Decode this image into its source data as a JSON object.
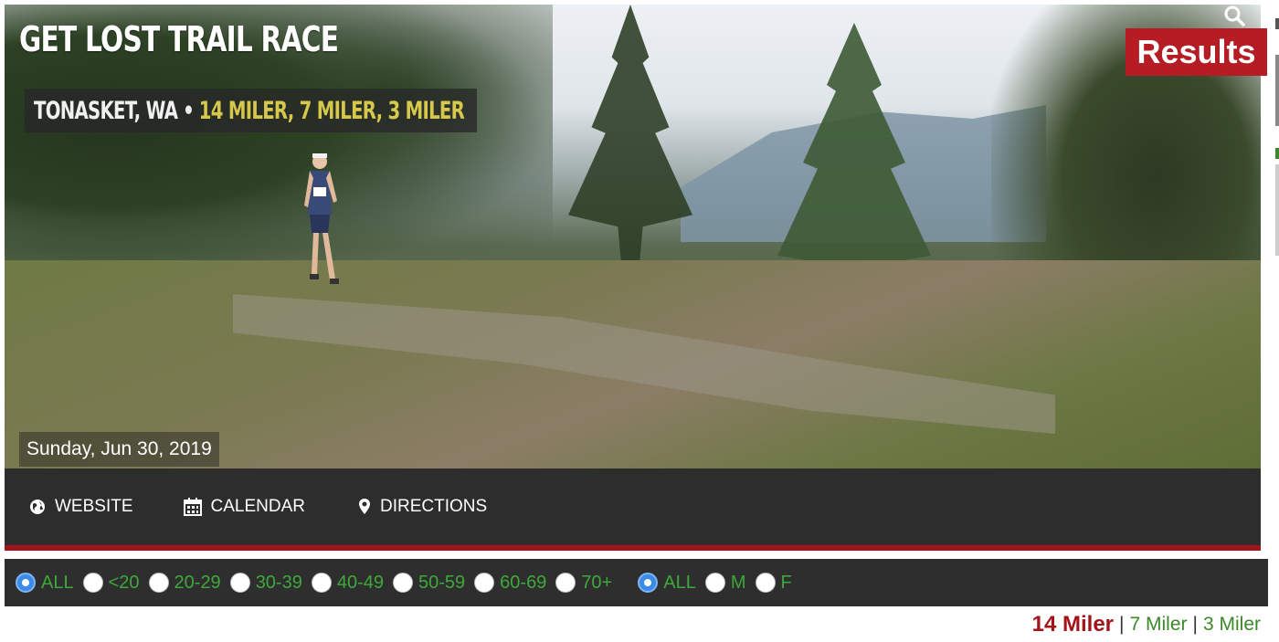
{
  "hero": {
    "title": "GET LOST TRAIL RACE",
    "location": "TONASKET, WA",
    "separator": "•",
    "distances": "14 MILER, 7 MILER, 3 MILER",
    "date": "Sunday, Jun 30, 2019",
    "results_badge": "Results"
  },
  "nav": {
    "website": "WEBSITE",
    "calendar": "CALENDAR",
    "directions": "DIRECTIONS"
  },
  "filters": {
    "age": [
      {
        "label": "ALL",
        "selected": true
      },
      {
        "label": "<20",
        "selected": false
      },
      {
        "label": "20-29",
        "selected": false
      },
      {
        "label": "30-39",
        "selected": false
      },
      {
        "label": "40-49",
        "selected": false
      },
      {
        "label": "50-59",
        "selected": false
      },
      {
        "label": "60-69",
        "selected": false
      },
      {
        "label": "70+",
        "selected": false
      }
    ],
    "gender": [
      {
        "label": "ALL",
        "selected": true
      },
      {
        "label": "M",
        "selected": false
      },
      {
        "label": "F",
        "selected": false
      }
    ]
  },
  "distance_tabs": {
    "active": "14 Miler",
    "items": [
      "7 Miler",
      "3 Miler"
    ],
    "separator": "|"
  },
  "colors": {
    "accent_red": "#a3141a",
    "badge_red": "#b51c24",
    "link_green": "#3fa83a",
    "dark_bar": "#2d2d2d",
    "radio_blue": "#3a8be8"
  }
}
